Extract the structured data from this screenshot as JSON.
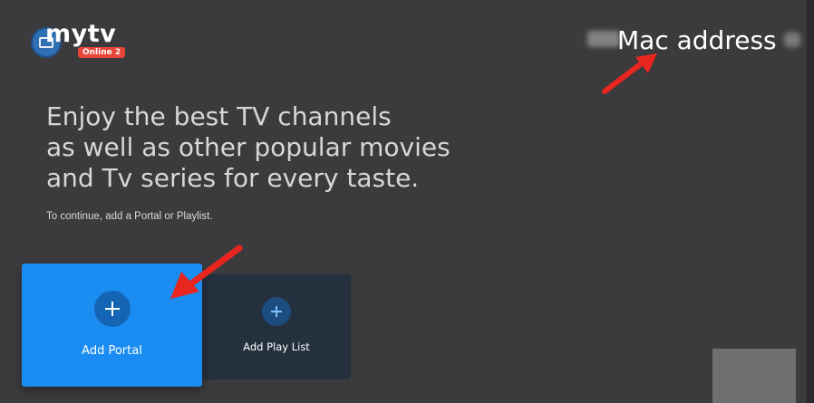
{
  "app": {
    "logo_text": "mytv",
    "logo_badge": "Online 2"
  },
  "header": {
    "mac_label": "Mac address"
  },
  "intro": {
    "headline_lines": [
      "Enjoy the best TV channels",
      "as well as other popular movies",
      "and Tv series for every taste."
    ],
    "subtext": "To continue, add a Portal or Playlist."
  },
  "cards": {
    "portal": {
      "label": "Add Portal",
      "icon": "plus-icon"
    },
    "playlist": {
      "label": "Add Play List",
      "icon": "plus-icon"
    }
  },
  "colors": {
    "background": "#3b3b3d",
    "portal_card": "#1b8cf2",
    "playlist_card": "#24303e",
    "annotation_arrow": "#e8251e",
    "logo_badge": "#e9443a"
  }
}
